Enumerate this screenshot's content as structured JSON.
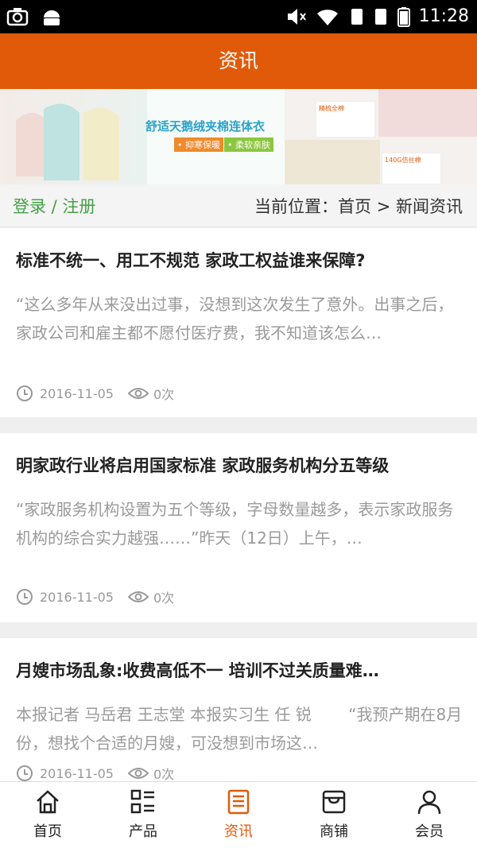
{
  "status_bar": {
    "time": "11:28",
    "icons": [
      "camera-icon",
      "android-icon",
      "mute-icon",
      "wifi-icon",
      "sim1-icon",
      "sim2-icon",
      "battery-icon"
    ]
  },
  "header": {
    "title": "资讯"
  },
  "banner": {
    "title": "舒适天鹅绒夹棉连体衣",
    "tags": [
      "• 抑寒保暖",
      "• 柔软亲肤"
    ],
    "card1": "精梳全棉",
    "card2": "140G仿丝棉"
  },
  "breadcrumb_bar": {
    "login_text": "登录 / 注册",
    "location_text": "当前位置：首页 > 新闻资讯"
  },
  "articles": [
    {
      "title": "标准不统一、用工不规范 家政工权益谁来保障?",
      "summary": "“这么多年从来没出过事，没想到这次发生了意外。出事之后，家政公司和雇主都不愿付医疗费，我不知道该怎么…",
      "date": "2016-11-05",
      "views": "0次"
    },
    {
      "title": "明家政行业将启用国家标准 家政服务机构分五等级",
      "summary": "“家政服务机构设置为五个等级，字母数量越多，表示家政服务机构的综合实力越强……”昨天（12日）上午，…",
      "date": "2016-11-05",
      "views": "0次"
    },
    {
      "title": "月嫂市场乱象:收费高低不一 培训不过关质量难…",
      "summary": "本报记者 马岳君 王志堂 本报实习生 任 锐 　　“我预产期在8月份，想找个合适的月嫂，可没想到市场这…",
      "date": "2016-11-05",
      "views": "0次"
    }
  ],
  "tabbar": {
    "tabs": [
      {
        "label": "首页",
        "icon": "home-icon"
      },
      {
        "label": "产品",
        "icon": "grid-list-icon"
      },
      {
        "label": "资讯",
        "icon": "document-icon",
        "active": true
      },
      {
        "label": "商铺",
        "icon": "store-icon"
      },
      {
        "label": "会员",
        "icon": "user-icon"
      }
    ]
  },
  "colors": {
    "accent": "#e15a09",
    "login_green": "#43a047"
  }
}
